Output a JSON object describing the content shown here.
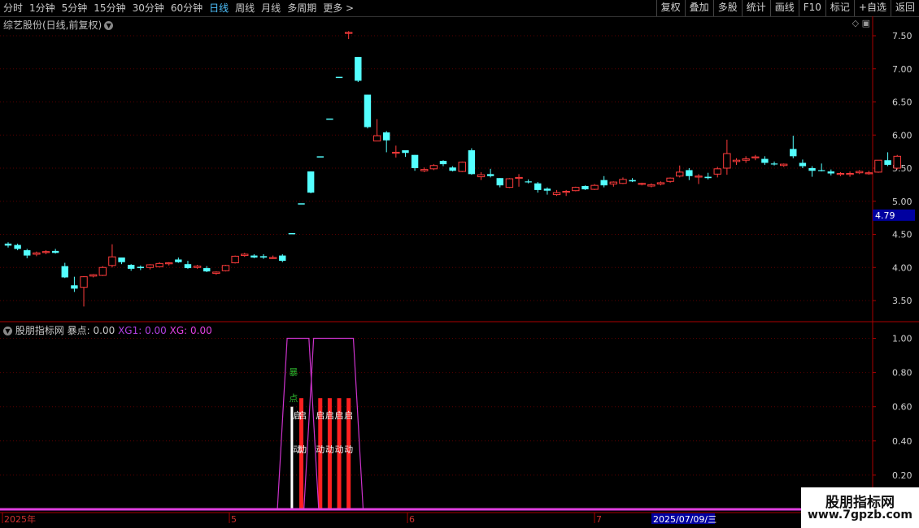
{
  "toolbar": {
    "periods": [
      "分时",
      "1分钟",
      "5分钟",
      "15分钟",
      "30分钟",
      "60分钟",
      "日线",
      "周线",
      "月线",
      "多周期",
      "更多 >"
    ],
    "active_period": "日线",
    "right_buttons": [
      "复权",
      "叠加",
      "多股",
      "统计",
      "画线",
      "F10",
      "标记",
      "+自选",
      "返回"
    ]
  },
  "main_panel": {
    "title": "综艺股份(日线,前复权)",
    "price_badge": "4.79",
    "y_ticks": [
      "7.50",
      "7.00",
      "6.50",
      "6.00",
      "5.50",
      "5.00",
      "4.50",
      "4.00",
      "3.50"
    ]
  },
  "indicator_panel": {
    "title": "股朋指标网",
    "values_text": "暴点: 0.00",
    "xg1_text": "XG1: 0.00",
    "xg_text": "XG: 0.00",
    "y_ticks": [
      "1.00",
      "0.80",
      "0.60",
      "0.40",
      "0.20"
    ],
    "signal_labels": {
      "bao": "暴",
      "dian": "点",
      "qi": "启",
      "dong": "动"
    }
  },
  "x_axis": {
    "labels": [
      "2025年",
      "5",
      "6",
      "7"
    ],
    "highlight_date": "2025/07/09/三"
  },
  "watermark": {
    "line1": "股朋指标网",
    "line2": "www.7gpzb.com"
  },
  "colors": {
    "up": "#ff3c3c",
    "down": "#54ffff",
    "indicator_line": "#cc33cc",
    "signal_bar": "#ff2020",
    "axis": "#aa0000"
  },
  "chart_data": [
    {
      "type": "candlestick",
      "title": "综艺股份(日线,前复权)",
      "ylim": [
        3.25,
        7.7
      ],
      "ohlc": [
        [
          4.36,
          4.38,
          4.3,
          4.33
        ],
        [
          4.34,
          4.36,
          4.26,
          4.28
        ],
        [
          4.26,
          4.28,
          4.14,
          4.18
        ],
        [
          4.2,
          4.24,
          4.17,
          4.22
        ],
        [
          4.23,
          4.26,
          4.2,
          4.24
        ],
        [
          4.25,
          4.28,
          4.21,
          4.22
        ],
        [
          4.02,
          4.07,
          3.84,
          3.85
        ],
        [
          3.73,
          3.86,
          3.63,
          3.68
        ],
        [
          3.7,
          3.87,
          3.41,
          3.86
        ],
        [
          3.87,
          3.9,
          3.85,
          3.89
        ],
        [
          3.88,
          4.02,
          3.87,
          4.0
        ],
        [
          4.03,
          4.35,
          4.0,
          4.16
        ],
        [
          4.15,
          4.15,
          4.05,
          4.08
        ],
        [
          4.04,
          4.05,
          3.95,
          3.98
        ],
        [
          4.01,
          4.03,
          3.96,
          3.99
        ],
        [
          4.0,
          4.05,
          3.97,
          4.04
        ],
        [
          4.01,
          4.08,
          4.0,
          4.06
        ],
        [
          4.06,
          4.08,
          4.03,
          4.07
        ],
        [
          4.12,
          4.15,
          4.07,
          4.08
        ],
        [
          4.05,
          4.1,
          3.98,
          3.99
        ],
        [
          4.0,
          4.04,
          3.98,
          4.02
        ],
        [
          3.99,
          4.02,
          3.93,
          3.94
        ],
        [
          3.91,
          3.94,
          3.89,
          3.93
        ],
        [
          3.95,
          4.04,
          3.94,
          4.03
        ],
        [
          4.07,
          4.18,
          4.06,
          4.17
        ],
        [
          4.18,
          4.22,
          4.16,
          4.2
        ],
        [
          4.18,
          4.2,
          4.14,
          4.15
        ],
        [
          4.17,
          4.2,
          4.13,
          4.15
        ],
        [
          4.15,
          4.18,
          4.13,
          4.15
        ],
        [
          4.18,
          4.2,
          4.08,
          4.1
        ],
        [
          4.51,
          4.51,
          4.51,
          4.51
        ],
        [
          4.96,
          4.96,
          4.96,
          4.96
        ],
        [
          5.45,
          5.45,
          5.12,
          5.13
        ],
        [
          5.67,
          5.67,
          5.67,
          5.67
        ],
        [
          6.24,
          6.24,
          6.24,
          6.24
        ],
        [
          6.87,
          6.87,
          6.87,
          6.87
        ],
        [
          7.55,
          7.57,
          7.45,
          7.55
        ],
        [
          7.18,
          7.18,
          6.8,
          6.82
        ],
        [
          6.61,
          6.61,
          6.1,
          6.12
        ],
        [
          5.91,
          6.24,
          5.91,
          5.99
        ],
        [
          6.04,
          6.06,
          5.74,
          5.92
        ],
        [
          5.74,
          5.84,
          5.66,
          5.74
        ],
        [
          5.77,
          5.77,
          5.67,
          5.73
        ],
        [
          5.7,
          5.7,
          5.46,
          5.5
        ],
        [
          5.46,
          5.51,
          5.44,
          5.48
        ],
        [
          5.49,
          5.56,
          5.47,
          5.54
        ],
        [
          5.61,
          5.62,
          5.53,
          5.56
        ],
        [
          5.51,
          5.53,
          5.45,
          5.46
        ],
        [
          5.45,
          5.6,
          5.44,
          5.59
        ],
        [
          5.77,
          5.8,
          5.4,
          5.41
        ],
        [
          5.37,
          5.44,
          5.32,
          5.4
        ],
        [
          5.41,
          5.49,
          5.36,
          5.38
        ],
        [
          5.35,
          5.35,
          5.21,
          5.24
        ],
        [
          5.21,
          5.35,
          5.2,
          5.34
        ],
        [
          5.36,
          5.41,
          5.22,
          5.36
        ],
        [
          5.3,
          5.33,
          5.27,
          5.29
        ],
        [
          5.27,
          5.29,
          5.13,
          5.17
        ],
        [
          5.19,
          5.21,
          5.1,
          5.16
        ],
        [
          5.1,
          5.17,
          5.08,
          5.13
        ],
        [
          5.14,
          5.17,
          5.08,
          5.15
        ],
        [
          5.16,
          5.22,
          5.15,
          5.21
        ],
        [
          5.23,
          5.24,
          5.17,
          5.18
        ],
        [
          5.18,
          5.26,
          5.17,
          5.24
        ],
        [
          5.32,
          5.38,
          5.21,
          5.24
        ],
        [
          5.26,
          5.3,
          5.22,
          5.29
        ],
        [
          5.27,
          5.36,
          5.26,
          5.33
        ],
        [
          5.32,
          5.35,
          5.29,
          5.3
        ],
        [
          5.26,
          5.28,
          5.24,
          5.27
        ],
        [
          5.23,
          5.27,
          5.21,
          5.25
        ],
        [
          5.26,
          5.3,
          5.24,
          5.28
        ],
        [
          5.3,
          5.36,
          5.28,
          5.35
        ],
        [
          5.38,
          5.54,
          5.36,
          5.44
        ],
        [
          5.47,
          5.5,
          5.32,
          5.38
        ],
        [
          5.38,
          5.41,
          5.26,
          5.38
        ],
        [
          5.37,
          5.43,
          5.33,
          5.35
        ],
        [
          5.41,
          5.52,
          5.36,
          5.49
        ],
        [
          5.5,
          5.93,
          5.4,
          5.72
        ],
        [
          5.6,
          5.65,
          5.55,
          5.62
        ],
        [
          5.62,
          5.68,
          5.58,
          5.64
        ],
        [
          5.66,
          5.7,
          5.62,
          5.67
        ],
        [
          5.64,
          5.68,
          5.55,
          5.58
        ],
        [
          5.57,
          5.6,
          5.54,
          5.56
        ],
        [
          5.54,
          5.57,
          5.52,
          5.56
        ],
        [
          5.79,
          5.99,
          5.65,
          5.68
        ],
        [
          5.58,
          5.63,
          5.5,
          5.53
        ],
        [
          5.5,
          5.53,
          5.37,
          5.46
        ],
        [
          5.47,
          5.57,
          5.45,
          5.46
        ],
        [
          5.45,
          5.48,
          5.39,
          5.42
        ],
        [
          5.41,
          5.44,
          5.38,
          5.42
        ],
        [
          5.41,
          5.45,
          5.37,
          5.42
        ],
        [
          5.43,
          5.47,
          5.41,
          5.45
        ],
        [
          5.42,
          5.46,
          5.4,
          5.43
        ],
        [
          5.44,
          5.62,
          5.43,
          5.62
        ],
        [
          5.62,
          5.74,
          5.53,
          5.55
        ],
        [
          5.5,
          5.7,
          5.48,
          5.68
        ]
      ]
    },
    {
      "type": "area",
      "title": "股朋指标网",
      "ylim": [
        0,
        1.05
      ],
      "signal_ranges": [
        [
          29.5,
          31.8
        ],
        [
          32.3,
          36.5
        ]
      ],
      "signal_line_value": 1.0,
      "bars": [
        {
          "index": 30,
          "value": 0.6,
          "color": "white"
        },
        {
          "index": 31,
          "value": 0.65,
          "color": "red"
        },
        {
          "index": 33,
          "value": 0.65,
          "color": "red"
        },
        {
          "index": 34,
          "value": 0.65,
          "color": "red"
        },
        {
          "index": 35,
          "value": 0.65,
          "color": "red"
        },
        {
          "index": 36,
          "value": 0.65,
          "color": "red"
        }
      ]
    }
  ]
}
